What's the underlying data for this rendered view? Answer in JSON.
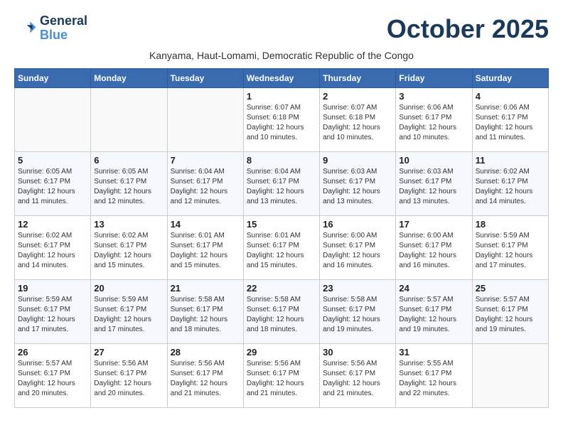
{
  "logo": {
    "line1": "General",
    "line2": "Blue"
  },
  "title": "October 2025",
  "subtitle": "Kanyama, Haut-Lomami, Democratic Republic of the Congo",
  "days_of_week": [
    "Sunday",
    "Monday",
    "Tuesday",
    "Wednesday",
    "Thursday",
    "Friday",
    "Saturday"
  ],
  "weeks": [
    [
      {
        "day": "",
        "info": ""
      },
      {
        "day": "",
        "info": ""
      },
      {
        "day": "",
        "info": ""
      },
      {
        "day": "1",
        "info": "Sunrise: 6:07 AM\nSunset: 6:18 PM\nDaylight: 12 hours\nand 10 minutes."
      },
      {
        "day": "2",
        "info": "Sunrise: 6:07 AM\nSunset: 6:18 PM\nDaylight: 12 hours\nand 10 minutes."
      },
      {
        "day": "3",
        "info": "Sunrise: 6:06 AM\nSunset: 6:17 PM\nDaylight: 12 hours\nand 10 minutes."
      },
      {
        "day": "4",
        "info": "Sunrise: 6:06 AM\nSunset: 6:17 PM\nDaylight: 12 hours\nand 11 minutes."
      }
    ],
    [
      {
        "day": "5",
        "info": "Sunrise: 6:05 AM\nSunset: 6:17 PM\nDaylight: 12 hours\nand 11 minutes."
      },
      {
        "day": "6",
        "info": "Sunrise: 6:05 AM\nSunset: 6:17 PM\nDaylight: 12 hours\nand 12 minutes."
      },
      {
        "day": "7",
        "info": "Sunrise: 6:04 AM\nSunset: 6:17 PM\nDaylight: 12 hours\nand 12 minutes."
      },
      {
        "day": "8",
        "info": "Sunrise: 6:04 AM\nSunset: 6:17 PM\nDaylight: 12 hours\nand 13 minutes."
      },
      {
        "day": "9",
        "info": "Sunrise: 6:03 AM\nSunset: 6:17 PM\nDaylight: 12 hours\nand 13 minutes."
      },
      {
        "day": "10",
        "info": "Sunrise: 6:03 AM\nSunset: 6:17 PM\nDaylight: 12 hours\nand 13 minutes."
      },
      {
        "day": "11",
        "info": "Sunrise: 6:02 AM\nSunset: 6:17 PM\nDaylight: 12 hours\nand 14 minutes."
      }
    ],
    [
      {
        "day": "12",
        "info": "Sunrise: 6:02 AM\nSunset: 6:17 PM\nDaylight: 12 hours\nand 14 minutes."
      },
      {
        "day": "13",
        "info": "Sunrise: 6:02 AM\nSunset: 6:17 PM\nDaylight: 12 hours\nand 15 minutes."
      },
      {
        "day": "14",
        "info": "Sunrise: 6:01 AM\nSunset: 6:17 PM\nDaylight: 12 hours\nand 15 minutes."
      },
      {
        "day": "15",
        "info": "Sunrise: 6:01 AM\nSunset: 6:17 PM\nDaylight: 12 hours\nand 15 minutes."
      },
      {
        "day": "16",
        "info": "Sunrise: 6:00 AM\nSunset: 6:17 PM\nDaylight: 12 hours\nand 16 minutes."
      },
      {
        "day": "17",
        "info": "Sunrise: 6:00 AM\nSunset: 6:17 PM\nDaylight: 12 hours\nand 16 minutes."
      },
      {
        "day": "18",
        "info": "Sunrise: 5:59 AM\nSunset: 6:17 PM\nDaylight: 12 hours\nand 17 minutes."
      }
    ],
    [
      {
        "day": "19",
        "info": "Sunrise: 5:59 AM\nSunset: 6:17 PM\nDaylight: 12 hours\nand 17 minutes."
      },
      {
        "day": "20",
        "info": "Sunrise: 5:59 AM\nSunset: 6:17 PM\nDaylight: 12 hours\nand 17 minutes."
      },
      {
        "day": "21",
        "info": "Sunrise: 5:58 AM\nSunset: 6:17 PM\nDaylight: 12 hours\nand 18 minutes."
      },
      {
        "day": "22",
        "info": "Sunrise: 5:58 AM\nSunset: 6:17 PM\nDaylight: 12 hours\nand 18 minutes."
      },
      {
        "day": "23",
        "info": "Sunrise: 5:58 AM\nSunset: 6:17 PM\nDaylight: 12 hours\nand 19 minutes."
      },
      {
        "day": "24",
        "info": "Sunrise: 5:57 AM\nSunset: 6:17 PM\nDaylight: 12 hours\nand 19 minutes."
      },
      {
        "day": "25",
        "info": "Sunrise: 5:57 AM\nSunset: 6:17 PM\nDaylight: 12 hours\nand 19 minutes."
      }
    ],
    [
      {
        "day": "26",
        "info": "Sunrise: 5:57 AM\nSunset: 6:17 PM\nDaylight: 12 hours\nand 20 minutes."
      },
      {
        "day": "27",
        "info": "Sunrise: 5:56 AM\nSunset: 6:17 PM\nDaylight: 12 hours\nand 20 minutes."
      },
      {
        "day": "28",
        "info": "Sunrise: 5:56 AM\nSunset: 6:17 PM\nDaylight: 12 hours\nand 21 minutes."
      },
      {
        "day": "29",
        "info": "Sunrise: 5:56 AM\nSunset: 6:17 PM\nDaylight: 12 hours\nand 21 minutes."
      },
      {
        "day": "30",
        "info": "Sunrise: 5:56 AM\nSunset: 6:17 PM\nDaylight: 12 hours\nand 21 minutes."
      },
      {
        "day": "31",
        "info": "Sunrise: 5:55 AM\nSunset: 6:17 PM\nDaylight: 12 hours\nand 22 minutes."
      },
      {
        "day": "",
        "info": ""
      }
    ]
  ]
}
